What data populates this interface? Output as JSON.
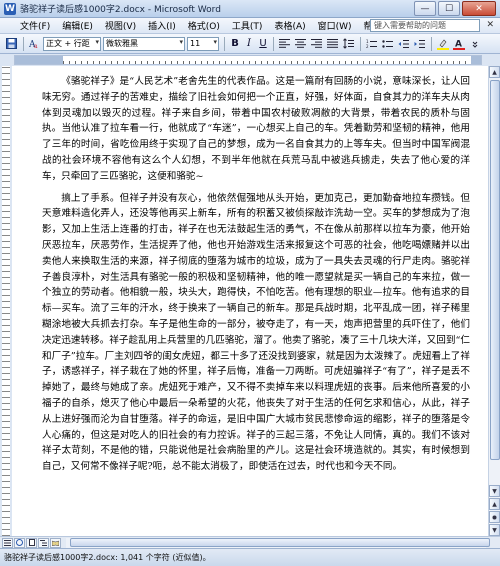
{
  "window": {
    "title": "骆驼祥子读后感1000字2.docx - Microsoft Word",
    "app_icon_glyph": "W",
    "controls": {
      "minimize": "—",
      "maximize": "☐",
      "close": "✕"
    }
  },
  "menubar": {
    "items": [
      "文件(F)",
      "编辑(E)",
      "视图(V)",
      "插入(I)",
      "格式(O)",
      "工具(T)",
      "表格(A)",
      "窗口(W)",
      "帮助(H)"
    ],
    "help_placeholder": "键入需要帮助的问题",
    "close_glyph": "✕"
  },
  "toolbar": {
    "style": "正文 + 行距",
    "font": "微软雅黑",
    "size": "11",
    "bold": "B",
    "italic": "I",
    "underline": "U",
    "font_color_glyph": "A"
  },
  "document": {
    "paragraphs": [
      "《骆驼祥子》是“人民艺术”老舍先生的代表作品。这是一篇耐有回肠的小说，意味深长，让人回味无穷。通过祥子的苦难史，描绘了旧社会如何把一个正直，好强，好体面，自食其力的洋车夫从肉体到灵魂加以毁灭的过程。祥子来自乡间，带着中国农村破败凋敝的大背景，带着农民的质朴与固执。当他认准了拉车看一行，他就成了“车迷”，一心想买上自己的车。凭着勤劳和坚韧的精神，他用了三年的时间，省吃俭用终于实现了自己的梦想，成为一名自食其力的上等车夫。但当时中国军阀混战的社会环境不容他有这么个人幻想，不到半年他就在兵荒马乱中被逃兵掳走，失去了他心爱的洋车，只牵回了三匹骆驼，这便和骆驼~",
      "搞上了手系。但祥子并没有灰心，他依然倔强地从头开始，更加克己，更加勤奋地拉车攒钱。但天意难料造化弄人，还没等他再买上新车，所有的积蓄又被侦探敲诈洗劫一空。买车的梦想成为了泡影，又加上生活上连番的打击，祥子在也无法鼓起生活的勇气，不在像从前那样以拉车为豪，他开始厌恶拉车，厌恶劳作，生活捉弄了他，他也开始游戏生活来报复这个可恶的社会，他吃喝嫖赌并以出卖他人来换取生活的来源，祥子彻底的堕落为城市的垃圾，成为了一具失去灵魂的行尸走肉。骆驼祥子善良淳朴，对生活具有骆驼一般的积极和坚韧精神，他的唯一愿望就是买一辆自己的车来拉，做一个独立的劳动者。他相貌一般，块头大，跑得快，不怕吃苦。他有理想的职业—拉车。他有追求的目标—买车。流了三年的汗水，终于换来了一辆自己的新车。那是兵战时期，北平乱成一团，祥子稀里糊涂地被大兵抓去打杂。车子是他生命的一部分，被夺走了，有一天，炮声把营里的兵吓住了，他们决定迅速转移。祥子趁乱用上兵营里的几匹骆驼，溜了。他卖了骆驼，凑了三十几块大洋，又回到“仁和厂子”拉车。厂主刘四爷的闺女虎妞，都三十多了还没找到婆家，就是因为太泼辣了。虎妞看上了祥子，诱惑祥子，祥子栽在了她的怀里，祥子后悔，准备一刀两断。可虎妞骗祥子“有了”，祥子是丢不掉她了，最终与她成了亲。虎妞死于难产，又不得不卖掉车来以料理虎妞的丧事。后来他所喜爱的小福子的自杀，熄灭了他心中最后一朵希望的火花，他丧失了对于生活的任何乞求和信心，从此，祥子从上进好强而沦为自甘堕落。祥子的命运，是旧中国广大城市贫民悲惨命运的缩影，祥子的堕落是令人心痛的，但这是对吃人的旧社会的有力控诉。祥子的三起三落，不免让人同情，真的。我们不该对祥子太苛刻，不是他的错，只能说他是社会病胎里的产儿。这是社会环境造就的。其实，有时候想到自己，又何常不像祥子呢?呃，总不能太消极了，即使活在过去，时代也和今天不同。"
    ]
  },
  "vscroll": {
    "up": "▲",
    "down": "▼",
    "prev": "▲",
    "next": "▼"
  },
  "statusbar": {
    "text": "骆驼祥子读后感1000字2.docx: 1,041 个字符 (近似值)。"
  }
}
